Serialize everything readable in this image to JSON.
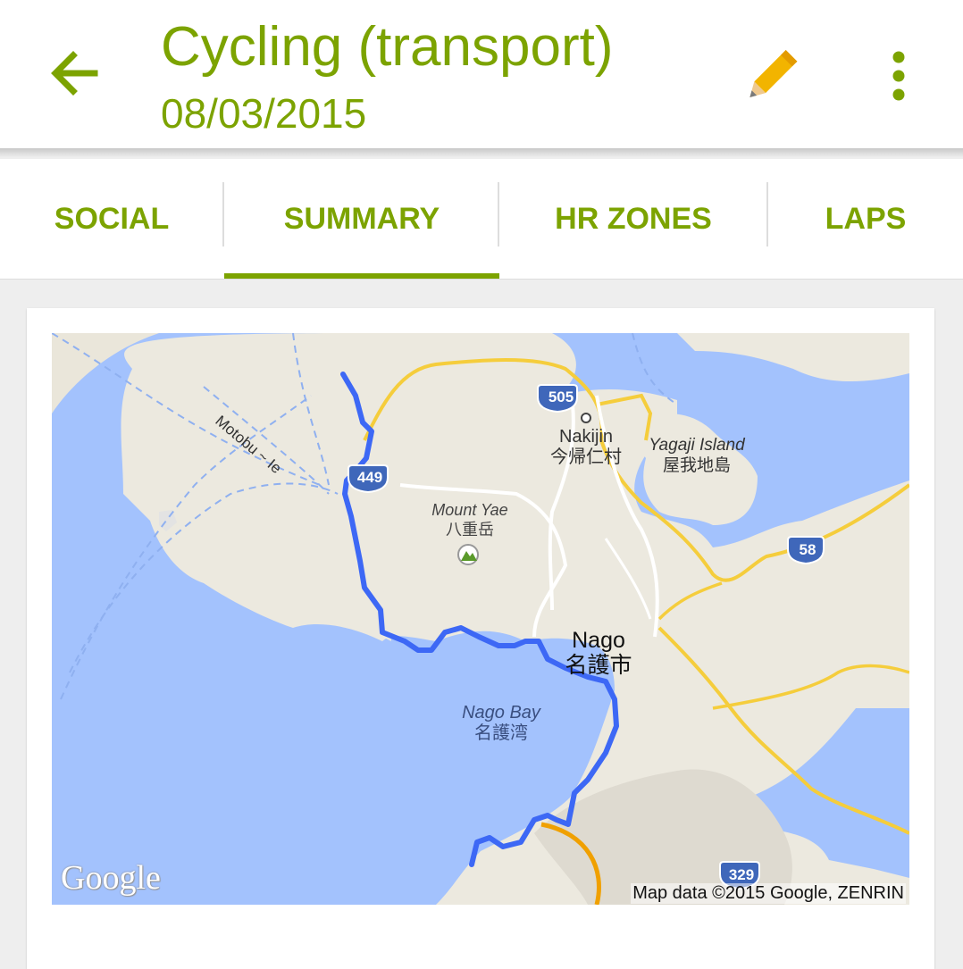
{
  "appbar": {
    "title": "Cycling (transport)",
    "date": "08/03/2015",
    "back_icon": "arrow-left-icon",
    "edit_icon": "pencil-icon",
    "more_icon": "more-vertical-icon"
  },
  "tabs": [
    {
      "label": "SOCIAL",
      "selected": false
    },
    {
      "label": "SUMMARY",
      "selected": true
    },
    {
      "label": "HR ZONES",
      "selected": false
    },
    {
      "label": "LAPS",
      "selected": false
    }
  ],
  "map": {
    "labels": {
      "ferry": "Motobu ~ Ie",
      "nakijin_en": "Nakijin",
      "nakijin_jp": "今帰仁村",
      "yagaji_en": "Yagaji Island",
      "yagaji_jp": "屋我地島",
      "mount_yae_en": "Mount Yae",
      "mount_yae_jp": "八重岳",
      "nago_en": "Nago",
      "nago_jp": "名護市",
      "nago_bay_en": "Nago Bay",
      "nago_bay_jp": "名護湾"
    },
    "route_shields": [
      "505",
      "449",
      "58",
      "329"
    ],
    "google_logo": "Google",
    "attribution": "Map data ©2015 Google, ZENRIN"
  },
  "colors": {
    "accent": "#7ca300",
    "water": "#a3c2fd",
    "land": "#ece9df",
    "route": "#3d68f5",
    "road": "#f7d24a",
    "shield": "#3f67ba",
    "pencil": "#f2b400"
  }
}
